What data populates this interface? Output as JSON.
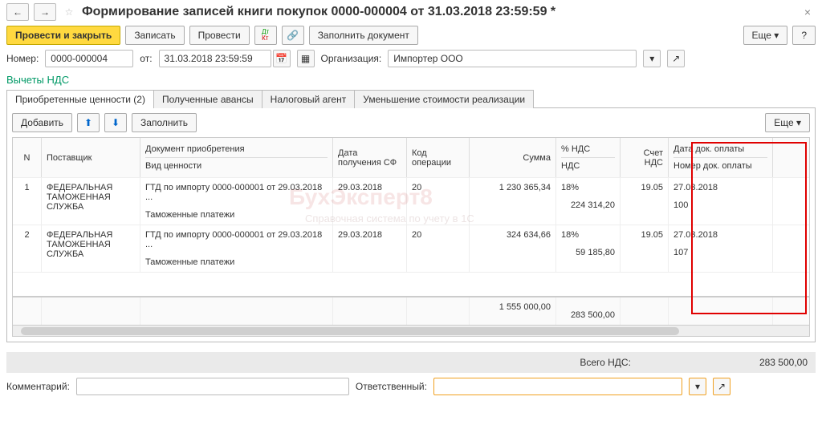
{
  "title": "Формирование записей книги покупок 0000-000004 от 31.03.2018 23:59:59 *",
  "nav": {
    "back": "←",
    "fwd": "→"
  },
  "toolbar": {
    "post_close": "Провести и закрыть",
    "save": "Записать",
    "post": "Провести",
    "fill_doc": "Заполнить документ",
    "more": "Еще ▾",
    "help": "?"
  },
  "fields": {
    "num_label": "Номер:",
    "num": "0000-000004",
    "date_label": "от:",
    "date": "31.03.2018 23:59:59",
    "org_label": "Организация:",
    "org": "Импортер ООО"
  },
  "section": "Вычеты НДС",
  "tabs": {
    "t0": "Приобретенные ценности (2)",
    "t1": "Полученные авансы",
    "t2": "Налоговый агент",
    "t3": "Уменьшение стоимости реализации"
  },
  "subtoolbar": {
    "add": "Добавить",
    "up": "⬆",
    "down": "⬇",
    "fill": "Заполнить",
    "more": "Еще ▾"
  },
  "headers": {
    "n": "N",
    "supplier": "Поставщик",
    "doc": "Документ приобретения",
    "valtype": "Вид ценности",
    "sfdate": "Дата получения СФ",
    "opcode": "Код операции",
    "sum": "Сумма",
    "ndspct": "% НДС",
    "nds": "НДС",
    "acc": "Счет НДС",
    "paydate": "Дата док. оплаты",
    "paynum": "Номер док. оплаты"
  },
  "rows": [
    {
      "n": "1",
      "supplier": "ФЕДЕРАЛЬНАЯ ТАМОЖЕННАЯ СЛУЖБА",
      "doc": "ГТД по импорту 0000-000001 от 29.03.2018 ...",
      "valtype": "Таможенные платежи",
      "sfdate": "29.03.2018",
      "opcode": "20",
      "sum": "1 230 365,34",
      "ndspct": "18%",
      "nds": "224 314,20",
      "acc": "19.05",
      "paydate": "27.03.2018",
      "paynum": "100"
    },
    {
      "n": "2",
      "supplier": "ФЕДЕРАЛЬНАЯ ТАМОЖЕННАЯ СЛУЖБА",
      "doc": "ГТД по импорту 0000-000001 от 29.03.2018 ...",
      "valtype": "Таможенные платежи",
      "sfdate": "29.03.2018",
      "opcode": "20",
      "sum": "324 634,66",
      "ndspct": "18%",
      "nds": "59 185,80",
      "acc": "19.05",
      "paydate": "27.03.2018",
      "paynum": "107"
    }
  ],
  "totals": {
    "sum": "1 555 000,00",
    "nds": "283 500,00"
  },
  "footer": {
    "total_nds_label": "Всего НДС:",
    "total_nds": "283 500,00",
    "comment_label": "Комментарий:",
    "comment": "",
    "resp_label": "Ответственный:",
    "resp": ""
  },
  "watermark1": "БухЭксперт8",
  "watermark2": "Справочная система по учету в 1С"
}
